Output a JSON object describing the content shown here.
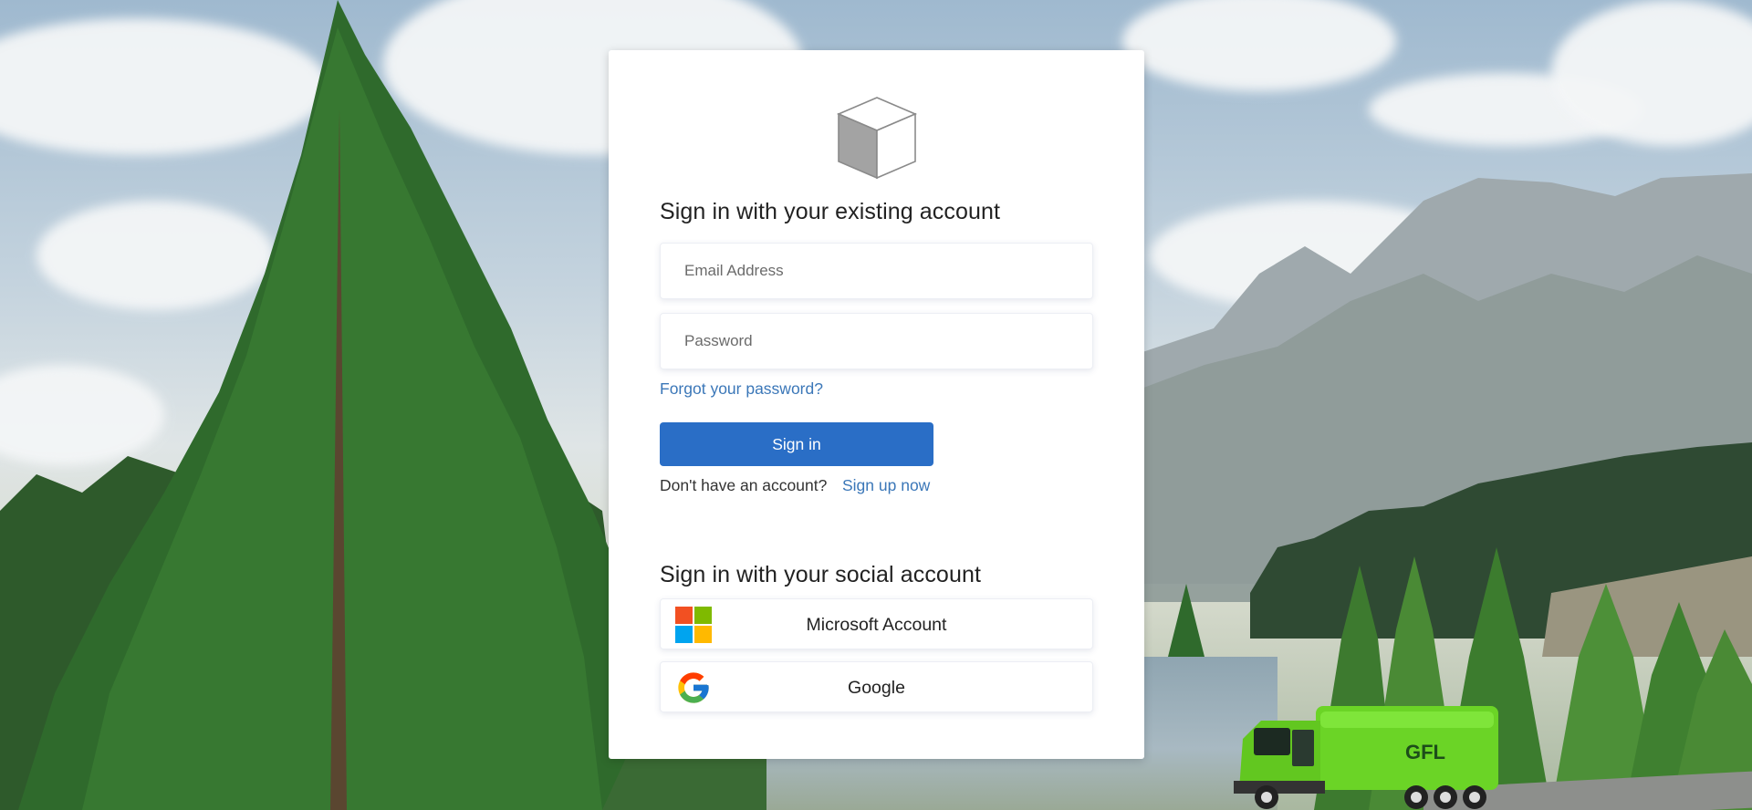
{
  "signin": {
    "heading": "Sign in with your existing account",
    "email_placeholder": "Email Address",
    "password_placeholder": "Password",
    "forgot_link": "Forgot your password?",
    "signin_button": "Sign in",
    "no_account_text": "Don't have an account?",
    "signup_link": "Sign up now"
  },
  "social": {
    "heading": "Sign in with your social account",
    "providers": [
      {
        "label": "Microsoft Account",
        "icon": "microsoft-logo-icon"
      },
      {
        "label": "Google",
        "icon": "google-logo-icon"
      }
    ]
  },
  "branding": {
    "logo_icon": "cube-icon",
    "truck_logo": "GFL"
  },
  "colors": {
    "primary_button": "#2a6ec6",
    "link": "#3b77b8",
    "card_background": "#ffffff",
    "truck": "#6bd426"
  }
}
